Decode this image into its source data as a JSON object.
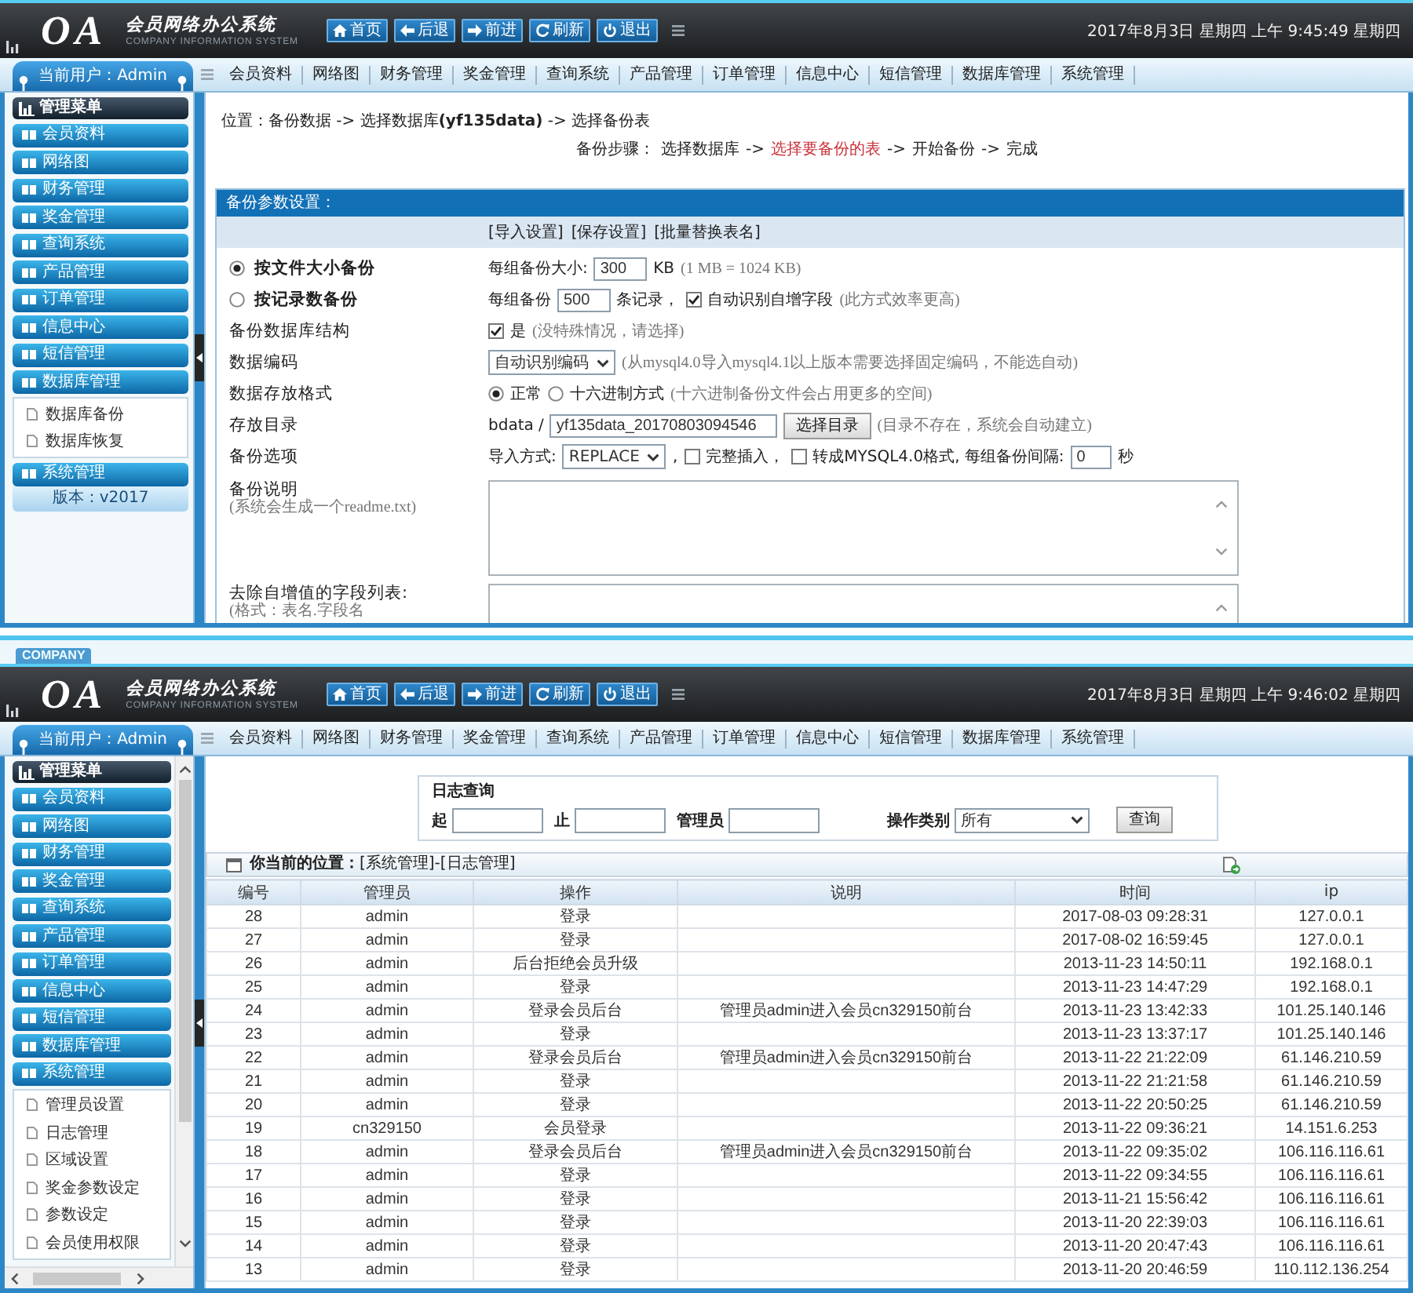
{
  "backup_window": {
    "header": {
      "logo": "OA",
      "title": "会员网络办公系统",
      "subtitle": "COMPANY INFORMATION SYSTEM",
      "toolbar": [
        {
          "kind": "home",
          "label": "首页"
        },
        {
          "kind": "back",
          "label": "后退"
        },
        {
          "kind": "forward",
          "label": "前进"
        },
        {
          "kind": "refresh",
          "label": "刷新"
        },
        {
          "kind": "exit",
          "label": "退出"
        }
      ],
      "datetime": "2017年8月3日 星期四 上午 9:45:49 星期四"
    },
    "nav": {
      "user": "当前用户：Admin",
      "menu": [
        "会员资料",
        "网络图",
        "财务管理",
        "奖金管理",
        "查询系统",
        "产品管理",
        "订单管理",
        "信息中心",
        "短信管理",
        "数据库管理",
        "系统管理"
      ]
    },
    "sidebar": {
      "heading": "管理菜单",
      "items": [
        {
          "label": "会员资料"
        },
        {
          "label": "网络图"
        },
        {
          "label": "财务管理"
        },
        {
          "label": "奖金管理"
        },
        {
          "label": "查询系统"
        },
        {
          "label": "产品管理"
        },
        {
          "label": "订单管理"
        },
        {
          "label": "信息中心"
        },
        {
          "label": "短信管理"
        },
        {
          "label": "数据库管理",
          "children": [
            {
              "label": "数据库备份"
            },
            {
              "label": "数据库恢复"
            }
          ]
        },
        {
          "label": "系统管理"
        }
      ],
      "version": "版本：v2017"
    },
    "content": {
      "breadcrumb": "位置：备份数据 -> 选择数据库**(yf135data)** -> 选择备份表",
      "steps": {
        "label": "备份步骤：",
        "items": [
          {
            "text": "选择数据库",
            "selected": false
          },
          {
            "prefix": "->",
            "text": "选择要备份的表",
            "selected": true
          },
          {
            "prefix": "->",
            "text": "开始备份",
            "selected": false
          },
          {
            "prefix": "->",
            "text": "完成",
            "selected": false
          }
        ]
      },
      "panel": {
        "title": "备份参数设置：",
        "links": [
          "[导入设置]",
          "[保存设置]",
          "[批量替换表名]"
        ],
        "rows": [
          {
            "kind": "choice",
            "label": "按文件大小备份",
            "selected": true,
            "controls": [
              {
                "kind": "text",
                "text": "每组备份大小:"
              },
              {
                "kind": "input",
                "value": "300"
              },
              {
                "kind": "text",
                "text": "KB"
              },
              {
                "kind": "hint",
                "text": "(1 MB = 1024 KB)"
              }
            ]
          },
          {
            "kind": "choice",
            "label": "按记录数备份",
            "selected": false,
            "controls": [
              {
                "kind": "text",
                "text": "每组备份"
              },
              {
                "kind": "input",
                "value": "500"
              },
              {
                "kind": "text",
                "text": "条记录，"
              },
              {
                "kind": "checkbox",
                "checked": true,
                "label": "自动识别自增字段"
              },
              {
                "kind": "hint",
                "text": "(此方式效率更高)"
              }
            ]
          },
          {
            "kind": "field",
            "label": "备份数据库结构",
            "controls": [
              {
                "kind": "checkbox",
                "checked": true,
                "label": "是"
              },
              {
                "kind": "hint",
                "text": "(没特殊情况，请选择)"
              }
            ]
          },
          {
            "kind": "field",
            "label": "数据编码",
            "controls": [
              {
                "kind": "select",
                "value": "自动识别编码"
              },
              {
                "kind": "hint",
                "text": "(从mysql4.0导入mysql4.1以上版本需要选择固定编码，不能选自动)"
              }
            ]
          },
          {
            "kind": "field",
            "label": "数据存放格式",
            "controls": [
              {
                "kind": "radio",
                "selected": true,
                "label": "正常"
              },
              {
                "kind": "radio",
                "selected": false,
                "label": "十六进制方式"
              },
              {
                "kind": "hint",
                "text": "(十六进制备份文件会占用更多的空间)"
              }
            ]
          },
          {
            "kind": "field",
            "label": "存放目录",
            "controls": [
              {
                "kind": "text",
                "text": "bdata /"
              },
              {
                "kind": "input",
                "value": "yf135data_20170803094546"
              },
              {
                "kind": "button",
                "label": "选择目录"
              },
              {
                "kind": "hint",
                "text": "(目录不存在，系统会自动建立)"
              }
            ]
          },
          {
            "kind": "field",
            "label": "备份选项",
            "controls": [
              {
                "kind": "text",
                "text": "导入方式:"
              },
              {
                "kind": "select",
                "value": "REPLACE"
              },
              {
                "kind": "text",
                "text": ","
              },
              {
                "kind": "checkbox",
                "checked": false,
                "label": "完整插入，"
              },
              {
                "kind": "checkbox",
                "checked": false,
                "label": "转成MYSQL4.0格式, 每组备份间隔:"
              },
              {
                "kind": "input",
                "value": "0"
              },
              {
                "kind": "text",
                "text": "秒"
              }
            ]
          },
          {
            "kind": "field",
            "label": "备份说明",
            "note": "(系统会生成一个readme.txt)",
            "controls": [
              {
                "kind": "textarea"
              }
            ]
          },
          {
            "kind": "field",
            "label": "去除自增值的字段列表:",
            "note": "(格式：表名.字段名",
            "controls": [
              {
                "kind": "textarea"
              }
            ]
          }
        ]
      }
    }
  },
  "log_window": {
    "badge": "COMPANY",
    "header": {
      "logo": "OA",
      "title": "会员网络办公系统",
      "subtitle": "COMPANY INFORMATION SYSTEM",
      "toolbar": [
        {
          "kind": "home",
          "label": "首页"
        },
        {
          "kind": "back",
          "label": "后退"
        },
        {
          "kind": "forward",
          "label": "前进"
        },
        {
          "kind": "refresh",
          "label": "刷新"
        },
        {
          "kind": "exit",
          "label": "退出"
        }
      ],
      "datetime": "2017年8月3日 星期四 上午 9:46:02 星期四"
    },
    "nav": {
      "user": "当前用户：Admin",
      "menu": [
        "会员资料",
        "网络图",
        "财务管理",
        "奖金管理",
        "查询系统",
        "产品管理",
        "订单管理",
        "信息中心",
        "短信管理",
        "数据库管理",
        "系统管理"
      ]
    },
    "sidebar": {
      "heading": "管理菜单",
      "scrollbar": true,
      "items": [
        {
          "label": "会员资料"
        },
        {
          "label": "网络图"
        },
        {
          "label": "财务管理"
        },
        {
          "label": "奖金管理"
        },
        {
          "label": "查询系统"
        },
        {
          "label": "产品管理"
        },
        {
          "label": "订单管理"
        },
        {
          "label": "信息中心"
        },
        {
          "label": "短信管理"
        },
        {
          "label": "数据库管理"
        },
        {
          "label": "系统管理",
          "children": [
            {
              "label": "管理员设置"
            },
            {
              "label": "日志管理"
            },
            {
              "label": "区域设置"
            },
            {
              "label": "奖金参数设定"
            },
            {
              "label": "参数设定"
            },
            {
              "label": "会员使用权限"
            }
          ]
        }
      ]
    },
    "content": {
      "query": {
        "title": "日志查询",
        "controls": [
          {
            "kind": "input",
            "label": "起"
          },
          {
            "kind": "input",
            "label": "止"
          },
          {
            "kind": "input",
            "label": "管理员"
          },
          {
            "kind": "select",
            "label": "操作类别",
            "value": "所有"
          },
          {
            "kind": "button",
            "label": "查询"
          }
        ]
      },
      "location": "**你当前的位置：**[系统管理]-[日志管理]",
      "table": {
        "columns": [
          "编号",
          "管理员",
          "操作",
          "说明",
          "时间",
          "ip"
        ],
        "rows": [
          {
            "number": "28",
            "administrator": "admin",
            "operation": "登录",
            "time": "2017-08-03 09:28:31",
            "ip": "127.0.0.1"
          },
          {
            "number": "27",
            "administrator": "admin",
            "operation": "登录",
            "time": "2017-08-02 16:59:45",
            "ip": "127.0.0.1"
          },
          {
            "number": "26",
            "administrator": "admin",
            "operation": "后台拒绝会员升级",
            "time": "2013-11-23 14:50:11",
            "ip": "192.168.0.1"
          },
          {
            "number": "25",
            "administrator": "admin",
            "operation": "登录",
            "time": "2013-11-23 14:47:29",
            "ip": "192.168.0.1"
          },
          {
            "number": "24",
            "administrator": "admin",
            "operation": "登录会员后台",
            "description": "管理员admin进入会员cn329150前台",
            "time": "2013-11-23 13:42:33",
            "ip": "101.25.140.146"
          },
          {
            "number": "23",
            "administrator": "admin",
            "operation": "登录",
            "time": "2013-11-23 13:37:17",
            "ip": "101.25.140.146"
          },
          {
            "number": "22",
            "administrator": "admin",
            "operation": "登录会员后台",
            "description": "管理员admin进入会员cn329150前台",
            "time": "2013-11-22 21:22:09",
            "ip": "61.146.210.59"
          },
          {
            "number": "21",
            "administrator": "admin",
            "operation": "登录",
            "time": "2013-11-22 21:21:58",
            "ip": "61.146.210.59"
          },
          {
            "number": "20",
            "administrator": "admin",
            "operation": "登录",
            "time": "2013-11-22 20:50:25",
            "ip": "61.146.210.59"
          },
          {
            "number": "19",
            "administrator": "cn329150",
            "operation": "会员登录",
            "time": "2013-11-22 09:36:21",
            "ip": "14.151.6.253"
          },
          {
            "number": "18",
            "administrator": "admin",
            "operation": "登录会员后台",
            "description": "管理员admin进入会员cn329150前台",
            "time": "2013-11-22 09:35:02",
            "ip": "106.116.116.61"
          },
          {
            "number": "17",
            "administrator": "admin",
            "operation": "登录",
            "time": "2013-11-22 09:34:55",
            "ip": "106.116.116.61"
          },
          {
            "number": "16",
            "administrator": "admin",
            "operation": "登录",
            "time": "2013-11-21 15:56:42",
            "ip": "106.116.116.61"
          },
          {
            "number": "15",
            "administrator": "admin",
            "operation": "登录",
            "time": "2013-11-20 22:39:03",
            "ip": "106.116.116.61"
          },
          {
            "number": "14",
            "administrator": "admin",
            "operation": "登录",
            "time": "2013-11-20 20:47:43",
            "ip": "106.116.116.61"
          },
          {
            "number": "13",
            "administrator": "admin",
            "operation": "登录",
            "time": "2013-11-20 20:46:59",
            "ip": "110.112.136.254"
          }
        ]
      }
    }
  }
}
